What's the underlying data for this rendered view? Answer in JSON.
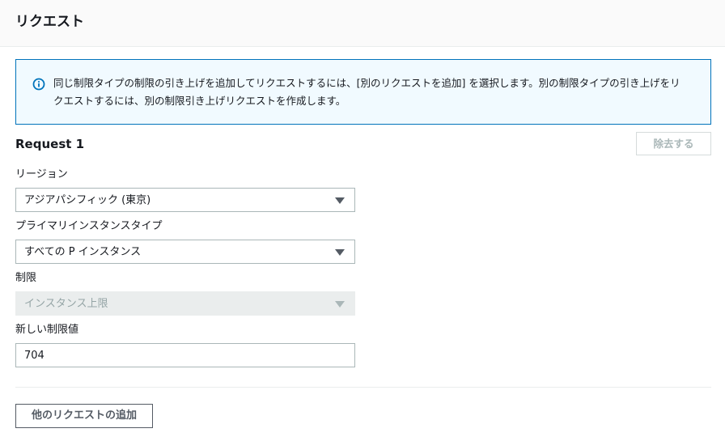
{
  "header": {
    "title": "リクエスト"
  },
  "info": {
    "line1": "同じ制限タイプの制限の引き上げを追加してリクエストするには、[別のリクエストを追加] を選択します。別の制限タイプの引き上げをリ",
    "line2": "クエストするには、別の制限引き上げリクエストを作成します。",
    "icon": "info-icon"
  },
  "request": {
    "title": "Request 1",
    "remove_label": "除去する",
    "region_label": "リージョン",
    "region_value": "アジアパシフィック (東京)",
    "instance_type_label": "プライマリインスタンスタイプ",
    "instance_type_value": "すべての P インスタンス",
    "limit_label": "制限",
    "limit_value": "インスタンス上限",
    "new_limit_label": "新しい制限値",
    "new_limit_value": "704"
  },
  "footer": {
    "add_label": "他のリクエストの追加"
  },
  "colors": {
    "accent": "#0073bb",
    "info_bg": "#f1faff"
  }
}
